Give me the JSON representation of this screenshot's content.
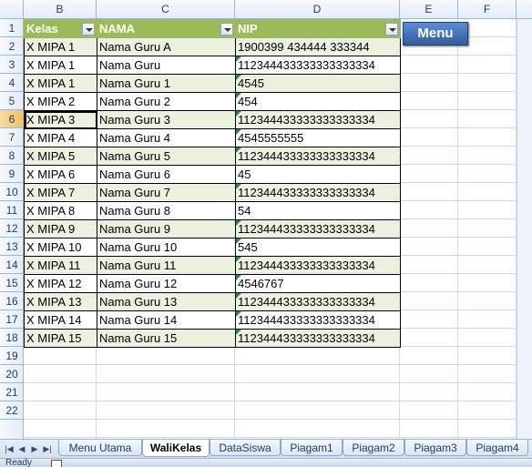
{
  "columns": [
    "B",
    "C",
    "D",
    "E",
    "F"
  ],
  "rows": [
    "1",
    "2",
    "3",
    "4",
    "5",
    "6",
    "7",
    "8",
    "9",
    "10",
    "11",
    "12",
    "13",
    "14",
    "15",
    "16",
    "17",
    "18",
    "19",
    "20",
    "21",
    "22"
  ],
  "table": {
    "headers": [
      "Kelas",
      "NAMA",
      "NIP"
    ],
    "data": [
      [
        "X MIPA 1",
        "Nama Guru A",
        "1900399 434444 333344"
      ],
      [
        "X MIPA 1",
        "Nama Guru",
        "112344433333333333334"
      ],
      [
        "X MIPA 1",
        "Nama Guru 1",
        "4545"
      ],
      [
        "X MIPA 2",
        "Nama Guru 2",
        "454"
      ],
      [
        "X MIPA 3",
        "Nama Guru 3",
        "112344433333333333334"
      ],
      [
        "X MIPA 4",
        "Nama Guru 4",
        "4545555555"
      ],
      [
        "X MIPA 5",
        "Nama Guru 5",
        "112344433333333333334"
      ],
      [
        "X MIPA 6",
        "Nama Guru 6",
        "45"
      ],
      [
        "X MIPA 7",
        "Nama Guru 7",
        "112344433333333333334"
      ],
      [
        "X MIPA 8",
        "Nama Guru 8",
        "54"
      ],
      [
        "X MIPA 9",
        "Nama Guru 9",
        "112344433333333333334"
      ],
      [
        "X MIPA 10",
        "Nama Guru 10",
        "545"
      ],
      [
        "X MIPA 11",
        "Nama Guru 11",
        "112344433333333333334"
      ],
      [
        "X MIPA 12",
        "Nama Guru 12",
        "4546767"
      ],
      [
        "X MIPA 13",
        "Nama Guru 13",
        "112344433333333333334"
      ],
      [
        "X MIPA 14",
        "Nama Guru 14",
        "112344433333333333334"
      ],
      [
        "X MIPA 15",
        "Nama Guru 15",
        "112344433333333333334"
      ]
    ]
  },
  "menu_button": "Menu",
  "sheet_tabs": [
    "Menu Utama",
    "WaliKelas",
    "DataSiswa",
    "Piagam1",
    "Piagam2",
    "Piagam3",
    "Piagam4"
  ],
  "active_tab": "WaliKelas",
  "status": "Ready",
  "colors": {
    "header_fill": "#9bbb59",
    "band_fill": "#ebf1de",
    "menu_button": "#2f5f9f"
  }
}
